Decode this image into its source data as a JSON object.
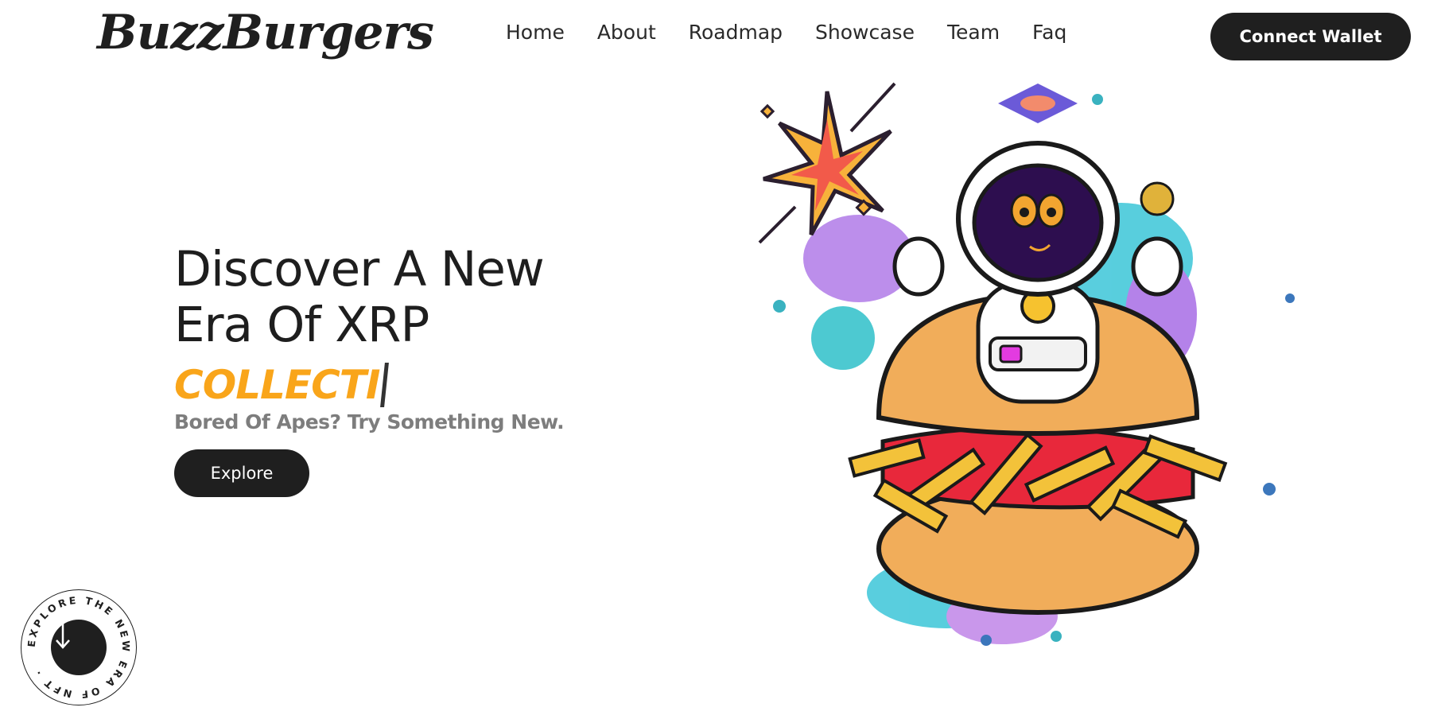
{
  "brand": {
    "logo": "BuzzBurgers"
  },
  "nav": {
    "items": [
      {
        "label": "Home"
      },
      {
        "label": "About"
      },
      {
        "label": "Roadmap"
      },
      {
        "label": "Showcase"
      },
      {
        "label": "Team"
      },
      {
        "label": "Faq"
      }
    ]
  },
  "header": {
    "connect_wallet_label": "Connect Wallet"
  },
  "hero": {
    "title_line1": "Discover A New",
    "title_line2": "Era Of XRP",
    "typed_text": "COLLECTI",
    "subtitle": "Bored Of Apes? Try Something New.",
    "explore_label": "Explore"
  },
  "scroll_badge": {
    "circle_text": "EXPLORE THE NEW ERA OF NFT ·",
    "arrow_icon": "arrow-down-icon"
  },
  "colors": {
    "accent": "#f9a51a",
    "dark": "#1f1f1f",
    "muted": "#7d7d7d"
  },
  "illustration": {
    "subject": "astronaut-burger-icon"
  }
}
